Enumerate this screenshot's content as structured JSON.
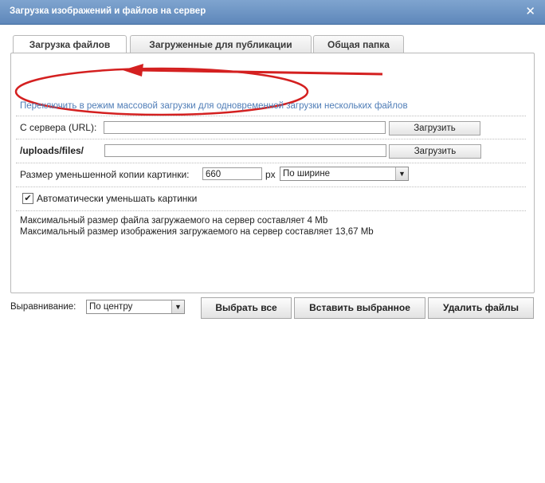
{
  "dialog": {
    "title": "Загрузка изображений и файлов на сервер",
    "close_symbol": "✕"
  },
  "tabs": [
    {
      "label": "Загрузка файлов",
      "active": true
    },
    {
      "label": "Загруженные для публикации",
      "active": false
    },
    {
      "label": "Общая папка",
      "active": false
    }
  ],
  "upload": {
    "mass_mode_link": "Переключить в режим массовой загрузки для одновременной загрузки нескольких файлов",
    "server_url_label": "С сервера (URL):",
    "server_url_value": "",
    "server_url_button": "Загрузить",
    "path_label": "/uploads/files/",
    "path_value": "",
    "path_button": "Загрузить",
    "thumb_label": "Размер уменьшенной копии картинки:",
    "thumb_value": "660",
    "thumb_unit": "px",
    "thumb_mode": "По ширине",
    "auto_resize_label": "Автоматически уменьшать картинки",
    "auto_resize_checked": true,
    "max_file_info": "Максимальный размер файла загружаемого на сервер составляет 4 Mb",
    "max_image_info": "Максимальный размер изображения загружаемого на сервер составляет 13,67 Mb"
  },
  "footer": {
    "align_label": "Выравнивание:",
    "align_value": "По центру",
    "select_all": "Выбрать все",
    "insert_selected": "Вставить выбранное",
    "delete_files": "Удалить файлы"
  },
  "colors": {
    "titlebar": "#6b91c2",
    "link": "#4f7db7",
    "annotation": "#d42020"
  }
}
